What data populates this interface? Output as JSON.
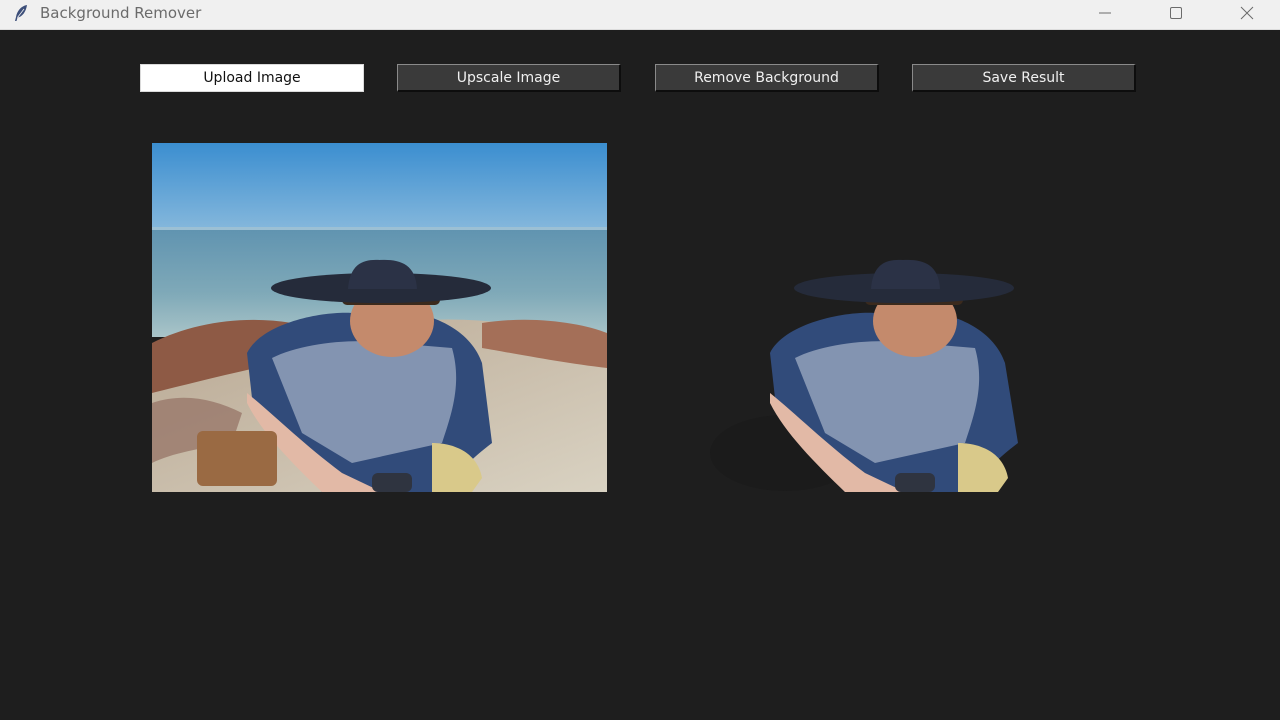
{
  "window": {
    "title": "Background Remover",
    "icons": {
      "app": "feather-icon",
      "minimize": "minimize-icon",
      "maximize": "maximize-icon",
      "close": "close-icon"
    }
  },
  "toolbar": {
    "upload_label": "Upload Image",
    "upscale_label": "Upscale Image",
    "remove_label": "Remove Background",
    "save_label": "Save Result"
  },
  "colors": {
    "background": "#1e1e1e",
    "titlebar": "#f0f0f0",
    "button_light": "#ffffff",
    "button_dark": "#3a3a3a"
  }
}
